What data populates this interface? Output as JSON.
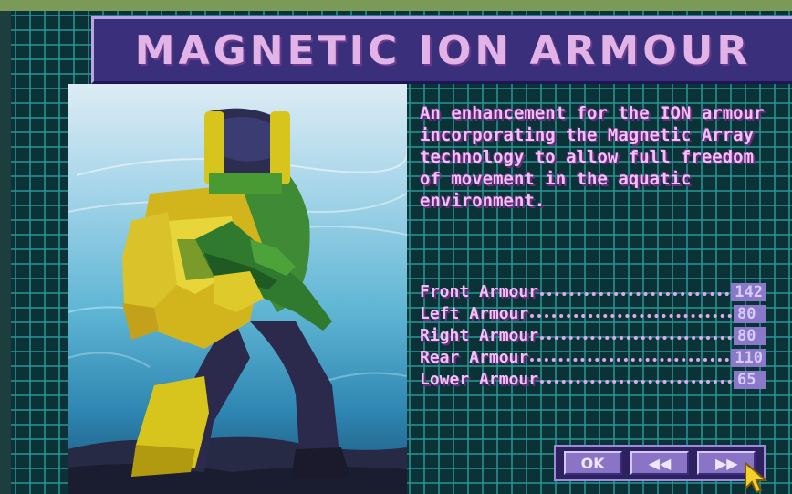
{
  "title": "MAGNETIC ION ARMOUR",
  "description": "An enhancement for the ION armour incorporating the Magnetic Array technology to allow full freedom of movement in the aquatic environment.",
  "stats": [
    {
      "label": "Front Armour",
      "value": "142"
    },
    {
      "label": "Left Armour",
      "value": "80"
    },
    {
      "label": "Right Armour",
      "value": "80"
    },
    {
      "label": "Rear Armour",
      "value": "110"
    },
    {
      "label": "Lower Armour",
      "value": "65"
    }
  ],
  "buttons": {
    "ok": "OK",
    "prev": "◀◀",
    "next": "▶▶"
  },
  "icons": {
    "prev": "rewind-icon",
    "next": "fast-forward-icon",
    "cursor": "arrow-cursor-icon"
  },
  "colors": {
    "title_bg": "#3a2f7a",
    "title_text": "#e2b3e6",
    "grid": "#2896a0",
    "text": "#f0c2f4",
    "button": "#8a74c6"
  }
}
